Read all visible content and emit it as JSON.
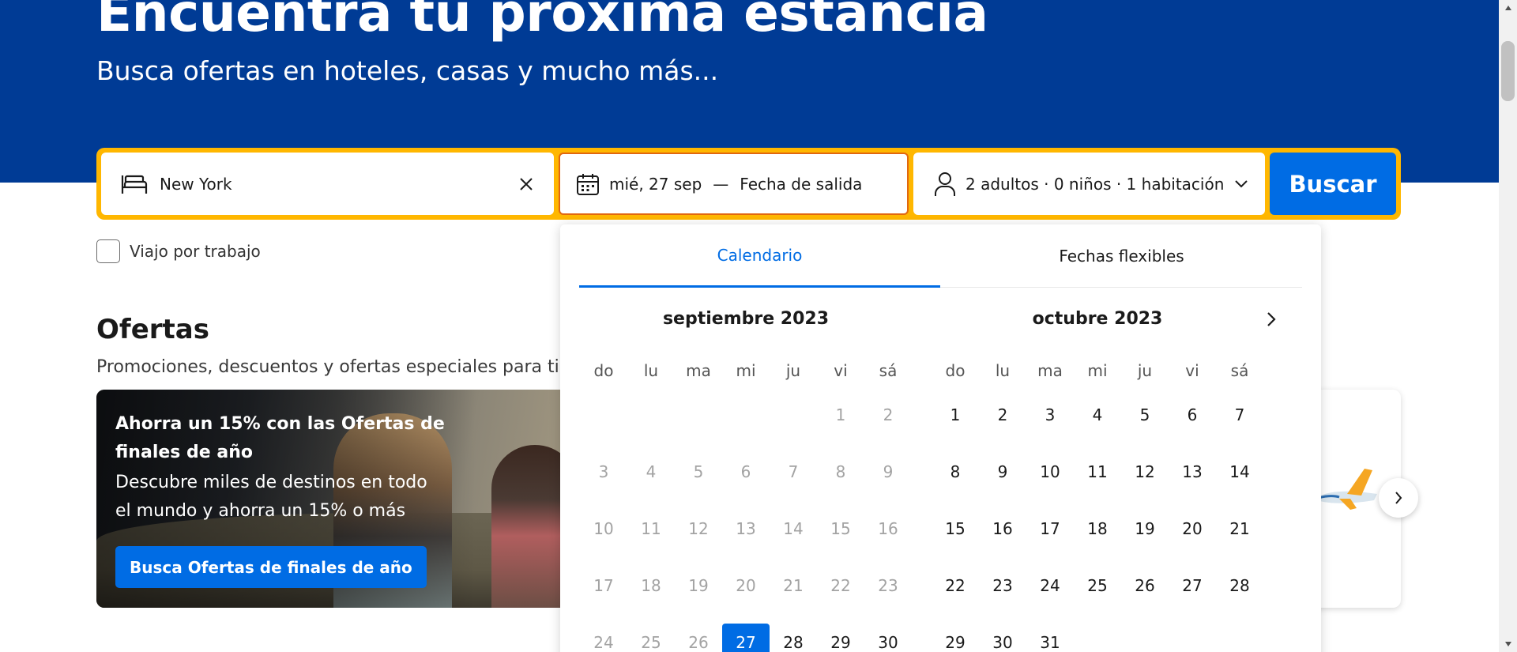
{
  "hero": {
    "title": "Encuentra tu próxima estancia",
    "subtitle": "Busca ofertas en hoteles, casas y mucho más..."
  },
  "search": {
    "destination": "New York",
    "checkin": "mié, 27 sep",
    "separator": "—",
    "checkout_placeholder": "Fecha de salida",
    "guests": "2 adultos · 0 niños · 1 habitación",
    "button": "Buscar"
  },
  "work_trip_label": "Viajo por trabajo",
  "offers": {
    "title": "Ofertas",
    "subtitle": "Promociones, descuentos y ofertas especiales para ti",
    "card": {
      "heading": "Ahorra un 15% con las Ofertas de finales de año",
      "description": "Descubre miles de destinos en todo el mundo y ahorra un 15% o más",
      "button": "Busca Ofertas de finales de año"
    }
  },
  "datepicker": {
    "tabs": [
      "Calendario",
      "Fechas flexibles"
    ],
    "active_tab": 0,
    "weekdays": [
      "do",
      "lu",
      "ma",
      "mi",
      "ju",
      "vi",
      "sá"
    ],
    "months": [
      {
        "title": "septiembre 2023",
        "weeks": [
          [
            "",
            "",
            "",
            "",
            "",
            "1",
            "2"
          ],
          [
            "3",
            "4",
            "5",
            "6",
            "7",
            "8",
            "9"
          ],
          [
            "10",
            "11",
            "12",
            "13",
            "14",
            "15",
            "16"
          ],
          [
            "17",
            "18",
            "19",
            "20",
            "21",
            "22",
            "23"
          ],
          [
            "24",
            "25",
            "26",
            "27",
            "28",
            "29",
            "30"
          ]
        ],
        "past_until": "26",
        "selected": "27"
      },
      {
        "title": "octubre 2023",
        "weeks": [
          [
            "1",
            "2",
            "3",
            "4",
            "5",
            "6",
            "7"
          ],
          [
            "8",
            "9",
            "10",
            "11",
            "12",
            "13",
            "14"
          ],
          [
            "15",
            "16",
            "17",
            "18",
            "19",
            "20",
            "21"
          ],
          [
            "22",
            "23",
            "24",
            "25",
            "26",
            "27",
            "28"
          ],
          [
            "29",
            "30",
            "31",
            "",
            "",
            "",
            ""
          ]
        ]
      }
    ]
  },
  "colors": {
    "brand_blue": "#003b95",
    "action_blue": "#006ce4",
    "search_border": "#ffb700"
  }
}
